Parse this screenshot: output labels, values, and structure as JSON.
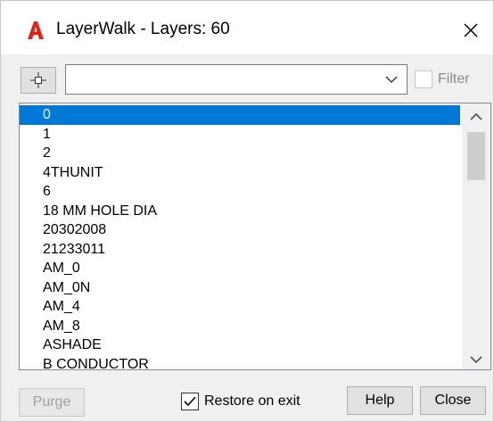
{
  "window": {
    "title": "LayerWalk - Layers: 60",
    "app_icon": "autocad-a-icon",
    "close_icon": "close-icon"
  },
  "toolbar": {
    "pick_icon": "crosshair-select-icon",
    "combo_value": "",
    "filter_label": "Filter",
    "filter_checked": false
  },
  "layers": {
    "selected": "0",
    "items": [
      "0",
      "1",
      "2",
      "4THUNIT",
      "6",
      "18 MM HOLE DIA",
      "20302008",
      "21233011",
      "AM_0",
      "AM_0N",
      "AM_4",
      "AM_8",
      "ASHADE",
      "B CONDUCTOR"
    ]
  },
  "footer": {
    "purge_label": "Purge",
    "restore_label": "Restore on exit",
    "restore_checked": true,
    "help_label": "Help",
    "close_label": "Close"
  },
  "colors": {
    "selection": "#0078d7",
    "autocad_red": "#e2231a"
  }
}
